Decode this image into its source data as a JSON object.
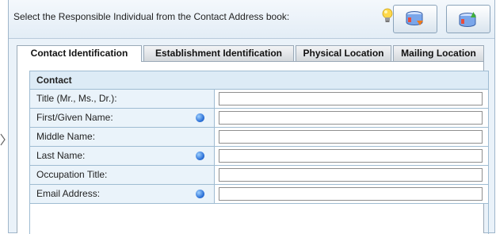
{
  "instruction": "Select the Responsible Individual from the Contact Address book:",
  "icons": {
    "tip": "lightbulb-icon",
    "address_book_import": "address-book-import-icon",
    "address_book_export": "address-book-export-icon"
  },
  "tabs": [
    {
      "label": "Contact Identification",
      "active": true
    },
    {
      "label": "Establishment Identification",
      "active": false
    },
    {
      "label": "Physical Location",
      "active": false
    },
    {
      "label": "Mailing Location",
      "active": false
    }
  ],
  "section": {
    "title": "Contact"
  },
  "fields": [
    {
      "label": "Title (Mr., Ms., Dr.):",
      "required": false,
      "value": ""
    },
    {
      "label": "First/Given Name:",
      "required": true,
      "value": ""
    },
    {
      "label": "Middle Name:",
      "required": false,
      "value": ""
    },
    {
      "label": "Last Name:",
      "required": true,
      "value": ""
    },
    {
      "label": "Occupation Title:",
      "required": false,
      "value": ""
    },
    {
      "label": "Email Address:",
      "required": true,
      "value": ""
    }
  ],
  "colors": {
    "panel_bg": "#eaf2f9",
    "label_bg": "#eaf3fa",
    "header_bg": "#ddebf6",
    "required_dot": "#2a6fd6"
  }
}
